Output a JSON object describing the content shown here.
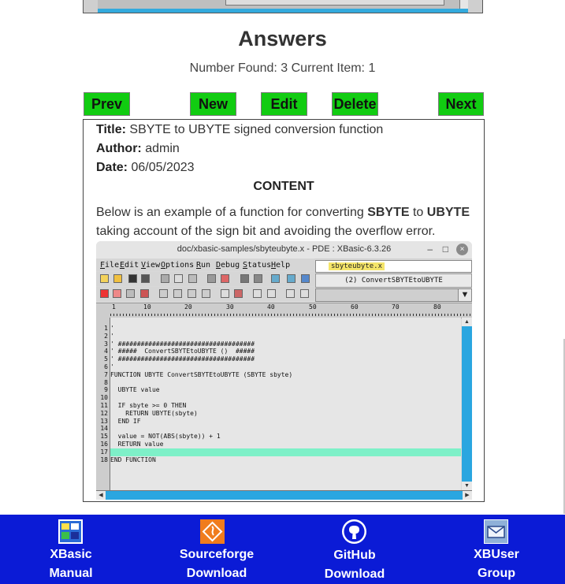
{
  "page": {
    "heading": "Answers",
    "number_found_label": "Number Found:",
    "number_found": "3",
    "current_item_label": "Current Item:",
    "current_item": "1"
  },
  "nav": {
    "prev": "Prev",
    "new": "New",
    "edit": "Edit",
    "delete": "Delete",
    "next": "Next",
    "button_color": "#11cc11"
  },
  "answer": {
    "title_label": "Title:",
    "title": "SBYTE to UBYTE signed conversion function",
    "author_label": "Author:",
    "author": "admin",
    "date_label": "Date:",
    "date": "06/05/2023",
    "content_heading": "CONTENT",
    "para_1": "Below is an example of a function for converting ",
    "para_bold_1": "SBYTE",
    "para_2": " to ",
    "para_bold_2": "UBYTE",
    "para_3": " taking account of the sign bit and avoiding the overflow error."
  },
  "screenshot": {
    "window_title": "doc/xbasic-samples/sbyteubyte.x - PDE : XBasic-6.3.26",
    "window_minimize": "–",
    "window_maximize": "□",
    "window_close": "×",
    "menu": [
      "File",
      "Edit",
      "View",
      "Options",
      "Run",
      "Debug",
      "Status",
      "Help"
    ],
    "filename": "sbyteubyte.x",
    "function_selector": "(2) ConvertSBYTEtoUBYTE",
    "ruler_marks": [
      "1",
      "10",
      "20",
      "30",
      "40",
      "50",
      "60",
      "70",
      "80"
    ],
    "line_numbers": [
      "1",
      "2",
      "3",
      "4",
      "5",
      "6",
      "7",
      "8",
      "9",
      "10",
      "11",
      "12",
      "13",
      "14",
      "15",
      "16",
      "17",
      "18"
    ],
    "code_lines": [
      "'",
      "'",
      "' ####################################",
      "' #####  ConvertSBYTEtoUBYTE ()  #####",
      "' ####################################",
      "'",
      "FUNCTION UBYTE ConvertSBYTEtoUBYTE (SBYTE sbyte)",
      "",
      "  UBYTE value",
      "",
      "  IF sbyte >= 0 THEN",
      "    RETURN UBYTE(sbyte)",
      "  END IF",
      "",
      "  value = NOT(ABS(sbyte)) + 1",
      "  RETURN value",
      "",
      "END FUNCTION"
    ],
    "highlighted_line": 17,
    "highlight_color": "#7ef0c8",
    "scrollbar_color": "#2aa6e0"
  },
  "footer": {
    "background": "#0b1bd6",
    "items": [
      {
        "line1": "XBasic",
        "line2": "Manual",
        "icon": "xbasic-manual-icon"
      },
      {
        "line1": "Sourceforge",
        "line2": "Download",
        "icon": "sourceforge-icon"
      },
      {
        "line1": "GitHub",
        "line2": "Download",
        "icon": "github-icon"
      },
      {
        "line1": "XBUser",
        "line2": "Group",
        "icon": "mail-group-icon"
      }
    ]
  }
}
